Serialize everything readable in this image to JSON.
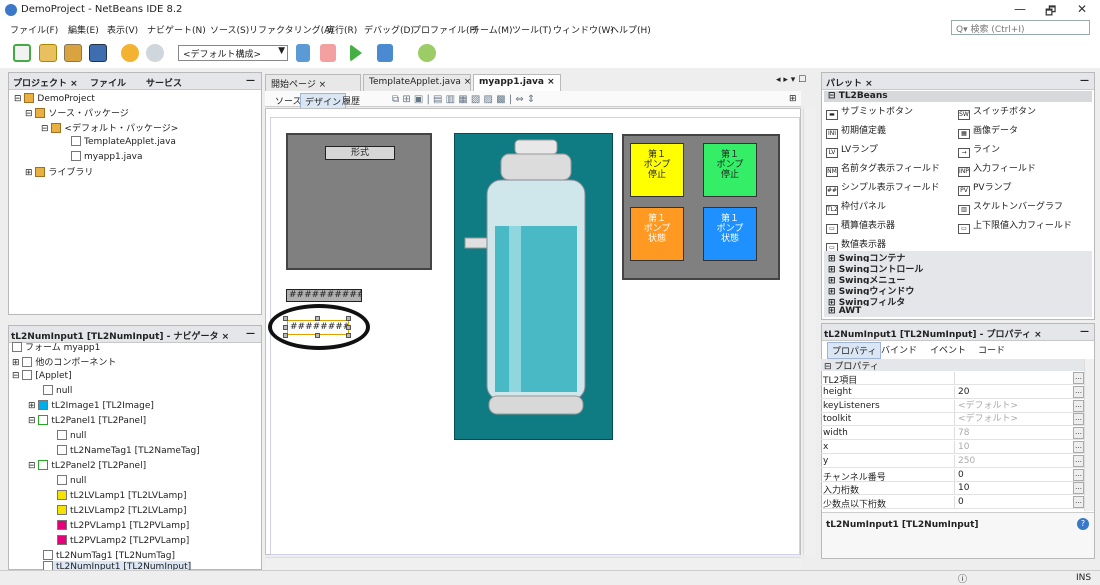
{
  "window": {
    "title": "DemoProject - NetBeans IDE 8.2",
    "minimize": "—",
    "maximize": "🗗",
    "close": "✕"
  },
  "menu": [
    "ファイル(F)",
    "編集(E)",
    "表示(V)",
    "ナビゲート(N)",
    "ソース(S)",
    "リファクタリング(A)",
    "実行(R)",
    "デバッグ(D)",
    "プロファイル(P)",
    "チーム(M)",
    "ツール(T)",
    "ウィンドウ(W)",
    "ヘルプ(H)"
  ],
  "search": {
    "placeholder": "Q▾ 検索 (Ctrl+I)"
  },
  "toolbar": {
    "config": "<デフォルト構成>"
  },
  "projects": {
    "tabs": [
      "プロジェクト ×",
      "ファイル",
      "サービス"
    ],
    "min": "—",
    "tree": [
      "DemoProject",
      "ソース・パッケージ",
      "<デフォルト・パッケージ>",
      "TemplateApplet.java",
      "myapp1.java",
      "ライブラリ"
    ]
  },
  "navigator": {
    "title": "tL2NumInput1 [TL2NumInput] - ナビゲータ ×",
    "min": "—",
    "tree": [
      "フォーム myapp1",
      "他のコンポーネント",
      "[Applet]",
      "null",
      "tL2Image1 [TL2Image]",
      "tL2Panel1 [TL2Panel]",
      "null",
      "tL2NameTag1 [TL2NameTag]",
      "tL2Panel2 [TL2Panel]",
      "null",
      "tL2LVLamp1 [TL2LVLamp]",
      "tL2LVLamp2 [TL2LVLamp]",
      "tL2PVLamp1 [TL2PVLamp]",
      "tL2PVLamp2 [TL2PVLamp]",
      "tL2NumTag1 [TL2NumTag]",
      "tL2NumInput1 [TL2NumInput]"
    ]
  },
  "editor": {
    "tabs": [
      "開始ページ ×",
      "TemplateApplet.java ×",
      "myapp1.java ×"
    ],
    "subtabs": [
      "ソース",
      "デザイン",
      "履歴"
    ]
  },
  "design": {
    "format_button": "形式",
    "name_tag": "##########",
    "num_input": "#########",
    "buttons": [
      {
        "label": "第１\nポンプ\n停止",
        "color": "#ffff00"
      },
      {
        "label": "第１\nポンプ\n停止",
        "color": "#33ee66"
      },
      {
        "label": "第１\nポンプ\n状態",
        "color": "#ff9922"
      },
      {
        "label": "第１\nポンプ\n状態",
        "color": "#1e90ff"
      }
    ]
  },
  "palette": {
    "title": "パレット ×",
    "min": "—",
    "category": "TL2Beans",
    "items": [
      [
        "サブミットボタン",
        "スイッチボタン"
      ],
      [
        "初期値定義",
        "画像データ"
      ],
      [
        "LVランプ",
        "ライン"
      ],
      [
        "名前タグ表示フィールド",
        "入力フィールド"
      ],
      [
        "シンプル表示フィールド",
        "PVランプ"
      ],
      [
        "枠付パネル",
        "スケルトンバーグラフ"
      ],
      [
        "積算値表示器",
        "上下限値入力フィールド"
      ],
      [
        "数値表示器",
        ""
      ]
    ],
    "icons": [
      [
        "▬",
        "SW"
      ],
      [
        "INI",
        "▦"
      ],
      [
        "LV",
        "→"
      ],
      [
        "NM",
        "INP"
      ],
      [
        "##",
        "PV"
      ],
      [
        "TL2",
        "▥"
      ],
      [
        "▭",
        "▭"
      ],
      [
        "▭",
        ""
      ]
    ],
    "cats": [
      "Swingコンテナ",
      "Swingコントロール",
      "Swingメニュー",
      "Swingウィンドウ",
      "Swingフィルタ",
      "AWT"
    ]
  },
  "properties": {
    "title": "tL2NumInput1 [TL2NumInput] - プロパティ ×",
    "min": "—",
    "tabs": [
      "プロパティ",
      "バインド",
      "イベント",
      "コード"
    ],
    "section": "プロパティ",
    "rows": [
      [
        "TL2項目",
        ""
      ],
      [
        "height",
        "20"
      ],
      [
        "keyListeners",
        "<デフォルト>"
      ],
      [
        "toolkit",
        "<デフォルト>"
      ],
      [
        "width",
        "78"
      ],
      [
        "x",
        "10"
      ],
      [
        "y",
        "250"
      ],
      [
        "チャンネル番号",
        "0"
      ],
      [
        "入力桁数",
        "10"
      ],
      [
        "少数点以下桁数",
        "0"
      ]
    ],
    "footer": "tL2NumInput1 [TL2NumInput]",
    "help": "?"
  },
  "status": {
    "ins": "INS"
  }
}
